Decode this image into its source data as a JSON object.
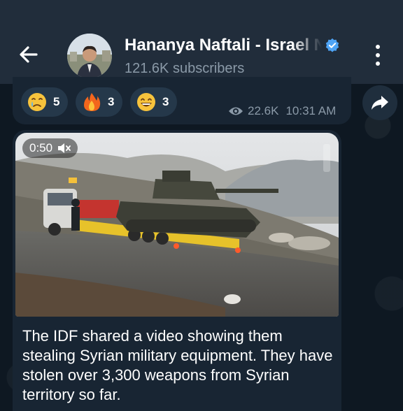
{
  "header": {
    "channel_name": "Hananya Naftali - Israel N",
    "subscribers": "121.6K subscribers",
    "back_icon": "arrow-left-icon",
    "verified_icon": "verified-badge-icon",
    "menu_icon": "more-vertical-icon"
  },
  "previous_post": {
    "reactions": [
      {
        "icon": "crying-face-emoji",
        "count": "5"
      },
      {
        "icon": "fire-emoji",
        "count": "3"
      },
      {
        "icon": "grinning-face-emoji",
        "count": "3"
      }
    ],
    "views": "22.6K",
    "time": "10:31 AM",
    "share_icon": "share-arrow-icon"
  },
  "post": {
    "video_duration": "0:50",
    "mute_icon": "speaker-muted-icon",
    "caption": "The IDF shared a video showing them stealing Syrian military equipment. They have stolen over 3,300 weapons from Syrian territory so far."
  },
  "colors": {
    "header_bg": "#212d3b",
    "bubble_bg": "#182533",
    "accent": "#4ea4f6",
    "muted_text": "#8b9aa8"
  }
}
